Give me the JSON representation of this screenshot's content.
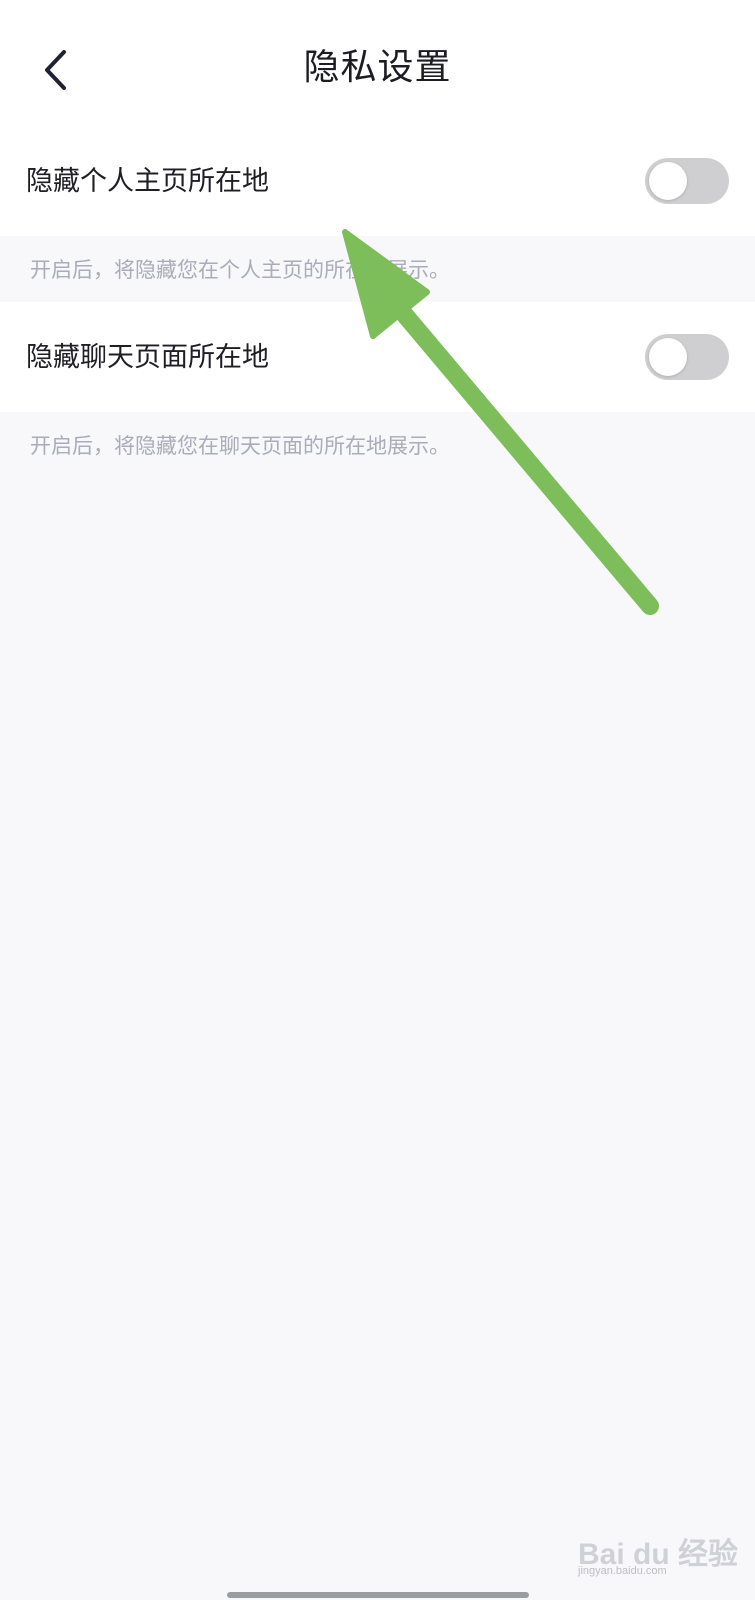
{
  "header": {
    "title": "隐私设置",
    "back_icon": "chevron-left-icon"
  },
  "settings": [
    {
      "label": "隐藏个人主页所在地",
      "description": "开启后，将隐藏您在个人主页的所在地展示。",
      "enabled": false
    },
    {
      "label": "隐藏聊天页面所在地",
      "description": "开启后，将隐藏您在聊天页面的所在地展示。",
      "enabled": false
    }
  ],
  "watermark": {
    "brand": "Bai du 经验",
    "site": "jingyan.baidu.com"
  },
  "colors": {
    "background": "#f8f8fb",
    "card": "#ffffff",
    "toggle_off": "#cfcfd2",
    "description_text": "#a9adb9",
    "annotation_arrow": "#7dbd5a"
  }
}
